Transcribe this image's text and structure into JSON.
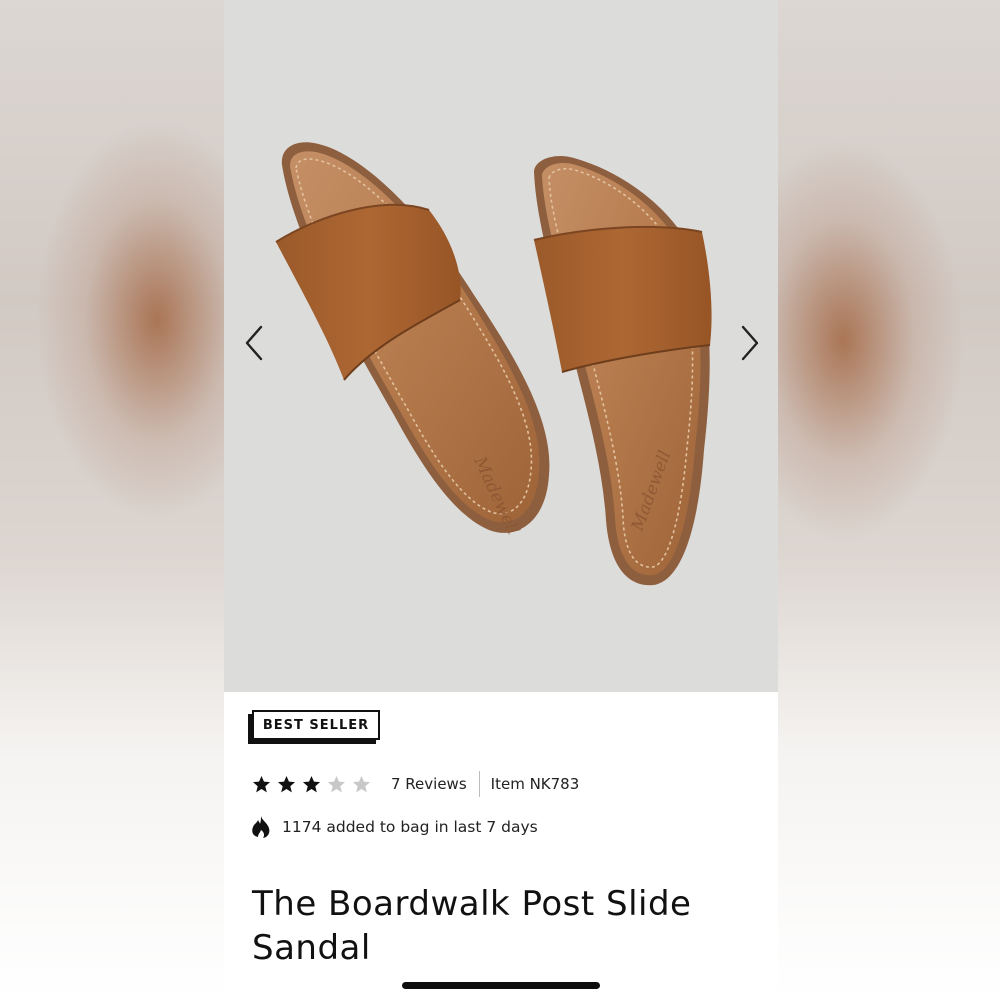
{
  "product": {
    "badge": "BEST SELLER",
    "rating": 3,
    "rating_max": 5,
    "reviews_label": "7 Reviews",
    "item_number": "Item NK783",
    "social_proof": "1174 added to bag in last 7 days",
    "title": "The Boardwalk Post Slide Sandal"
  },
  "gallery": {
    "prev_icon": "chevron-left-icon",
    "next_icon": "chevron-right-icon",
    "image_subject": "brown leather slide sandals",
    "insole_logo": "Madewell"
  },
  "colors": {
    "gallery_bg": "#dcdcdb",
    "leather": "#a8602c",
    "insole": "#b87a4a",
    "text": "#111111",
    "star_filled": "#111111",
    "star_empty": "#c8c8c8"
  }
}
